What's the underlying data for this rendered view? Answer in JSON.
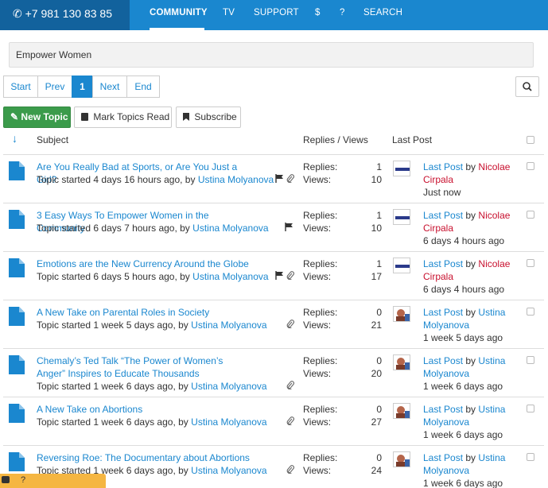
{
  "topbar": {
    "phone": "+7 981 130 83 85",
    "nav": [
      "COMMUNITY",
      "TV",
      "SUPPORT",
      "$",
      "?",
      "SEARCH"
    ]
  },
  "topic_title": "Empower Women",
  "pagination": {
    "start": "Start",
    "prev": "Prev",
    "current": "1",
    "next": "Next",
    "end": "End"
  },
  "buttons": {
    "new_topic": "New Topic",
    "mark_read": "Mark Topics Read",
    "subscribe": "Subscribe"
  },
  "headers": {
    "subject": "Subject",
    "replies_views": "Replies / Views",
    "last_post": "Last Post"
  },
  "labels": {
    "replies": "Replies:",
    "views": "Views:",
    "topic_started": "Topic started",
    "last_post": "Last Post",
    "by": "by"
  },
  "topics": [
    {
      "title": "Are You Really Bad at Sports, or Are You Just a Girl?",
      "age": "4 days 16 hours ago, by",
      "author": "Ustina Molyanova",
      "replies": "1",
      "views": "10",
      "last_by": "Nicolae Cirpala",
      "last_time": "Just now"
    },
    {
      "title": "3 Easy Ways To Empower Women in the Community",
      "age": "6 days 7 hours ago, by",
      "author": "Ustina Molyanova",
      "replies": "1",
      "views": "10",
      "last_by": "Nicolae Cirpala",
      "last_time": "6 days 4 hours ago"
    },
    {
      "title": "Emotions are the New Currency Around the Globe",
      "age": "6 days 5 hours ago, by",
      "author": "Ustina Molyanova",
      "replies": "1",
      "views": "17",
      "last_by": "Nicolae Cirpala",
      "last_time": "6 days 4 hours ago"
    },
    {
      "title": "A New Take on Parental Roles in Society",
      "age": "1 week 5 days ago, by",
      "author": "Ustina Molyanova",
      "replies": "0",
      "views": "21",
      "last_by": "Ustina Molyanova",
      "last_time": "1 week 5 days ago"
    },
    {
      "title": "Chemaly’s Ted Talk “The Power of Women’s Anger” Inspires to Educate Thousands",
      "age": "1 week 6 days ago, by",
      "author": "Ustina Molyanova",
      "replies": "0",
      "views": "20",
      "last_by": "Ustina Molyanova",
      "last_time": "1 week 6 days ago"
    },
    {
      "title": "A New Take on Abortions",
      "age": "1 week 6 days ago, by",
      "author": "Ustina Molyanova",
      "replies": "0",
      "views": "27",
      "last_by": "Ustina Molyanova",
      "last_time": "1 week 6 days ago"
    },
    {
      "title": "Reversing Roe: The Documentary about Abortions",
      "age": "1 week 6 days ago, by",
      "author": "Ustina Molyanova",
      "replies": "0",
      "views": "24",
      "last_by": "Ustina Molyanova",
      "last_time": "1 week 6 days ago"
    }
  ],
  "row_icons": [
    [
      "flag-icon",
      "paperclip-icon"
    ],
    [
      "flag-icon"
    ],
    [
      "flag-icon",
      "paperclip-icon"
    ],
    [
      "paperclip-icon"
    ],
    [
      "paperclip-icon"
    ],
    [
      "paperclip-icon"
    ],
    [
      "paperclip-icon"
    ]
  ],
  "chat_widget": {
    "label": "?"
  },
  "colors": {
    "brand_blue": "#1a87cf",
    "dark_blue": "#12629d",
    "green": "#3b9b4b",
    "author_red": "#c8102e"
  }
}
